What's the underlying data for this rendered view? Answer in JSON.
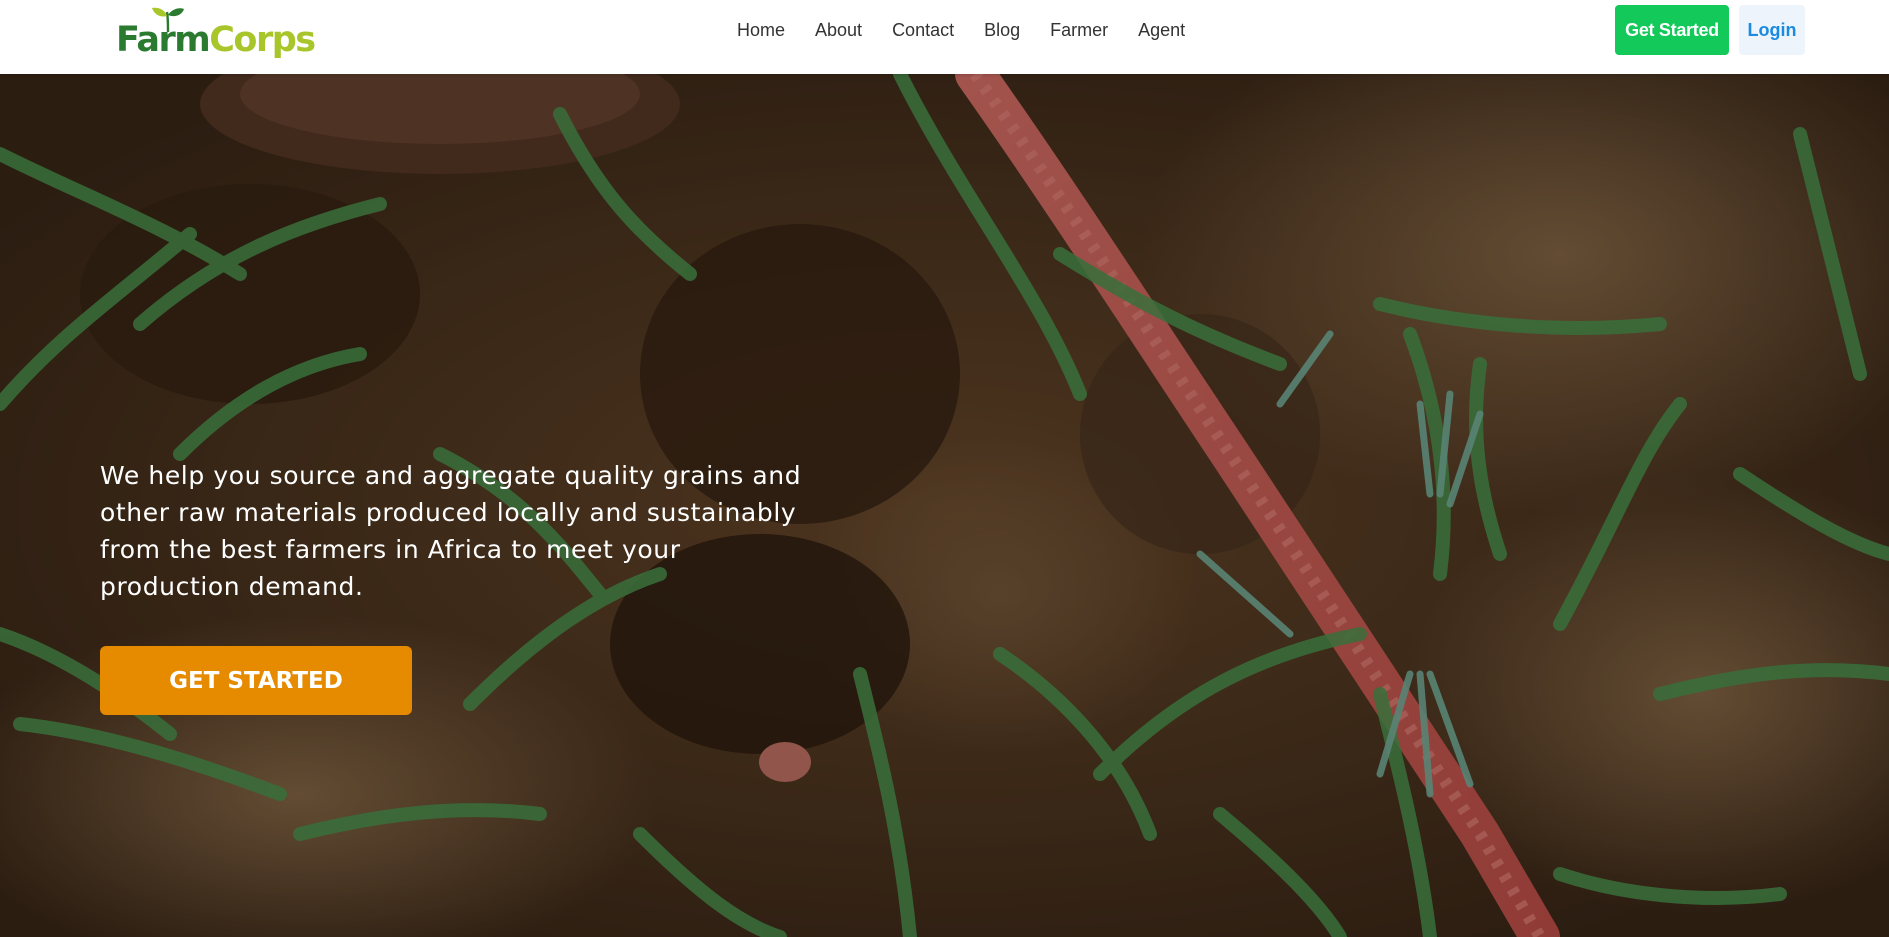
{
  "brand": {
    "name_part1": "Farm",
    "name_part2": "Corps",
    "colors": {
      "farm": "#2a7a30",
      "corps": "#a8c52a"
    }
  },
  "nav": {
    "links": [
      "Home",
      "About",
      "Contact",
      "Blog",
      "Farmer",
      "Agent"
    ],
    "get_started_label": "Get Started",
    "login_label": "Login",
    "colors": {
      "get_started_bg": "#12c95a",
      "login_text": "#1a8be0"
    }
  },
  "hero": {
    "description": "We help you source and aggregate quality grains and other raw materials produced locally and sustainably from the best farmers in Africa to meet your production demand.",
    "cta_label": "GET STARTED",
    "cta_color": "#e68a00",
    "background_image": "soil-with-seedlings-and-red-seed-rope"
  }
}
